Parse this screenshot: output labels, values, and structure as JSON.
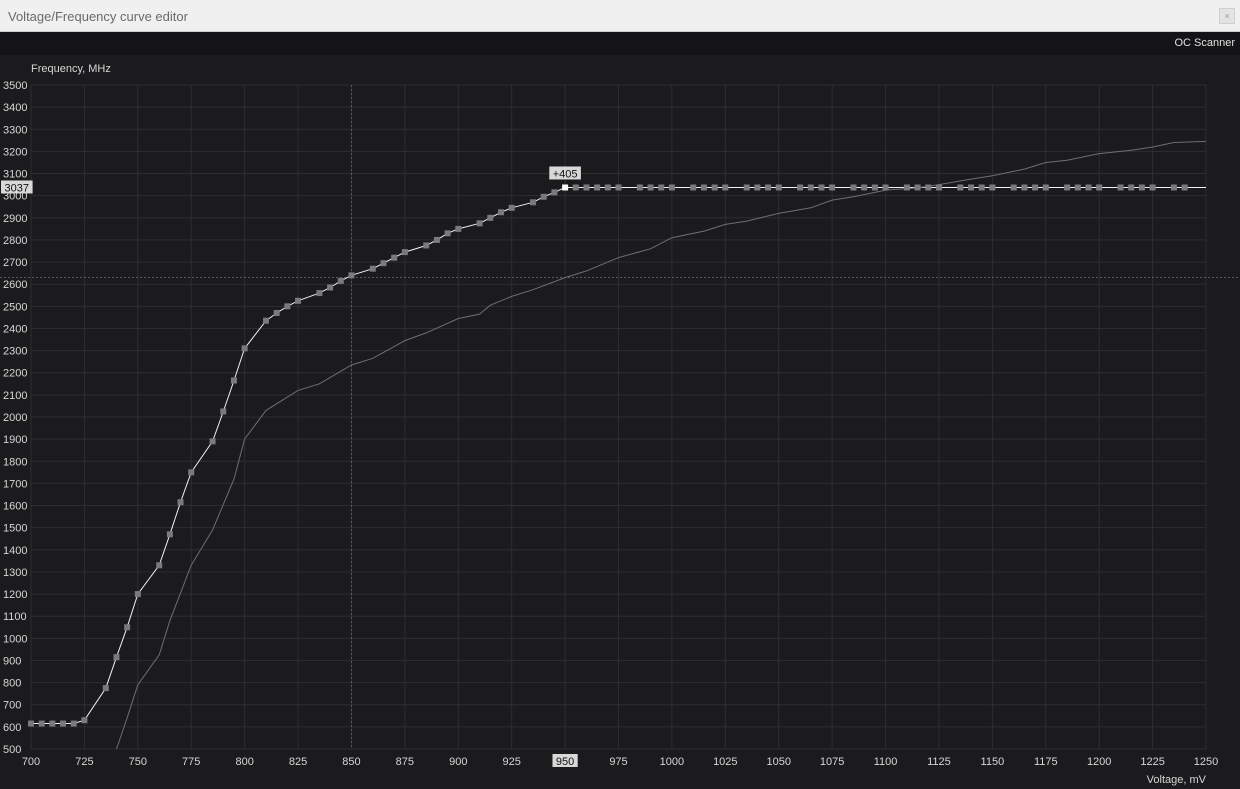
{
  "window": {
    "title": "Voltage/Frequency curve editor",
    "close_label": "×"
  },
  "toolbar": {
    "oc_scanner_label": "OC Scanner"
  },
  "colors": {
    "background": "#1b1b1d",
    "grid": "#2e2e31",
    "curve_active": "#f2f2f2",
    "curve_default": "#6f6f72",
    "point": "#7a7a7d",
    "point_selected": "#ffffff",
    "label_bg": "#d8d8d8",
    "label_text": "#111111"
  },
  "chart_data": {
    "type": "line",
    "xlabel": "Voltage, mV",
    "ylabel": "Frequency, MHz",
    "xlim": [
      700,
      1250
    ],
    "ylim": [
      500,
      3500
    ],
    "xticks": [
      700,
      725,
      750,
      775,
      800,
      825,
      850,
      875,
      900,
      925,
      950,
      975,
      1000,
      1025,
      1050,
      1075,
      1100,
      1125,
      1150,
      1175,
      1200,
      1225,
      1250
    ],
    "yticks": [
      500,
      600,
      700,
      800,
      900,
      1000,
      1100,
      1200,
      1300,
      1400,
      1500,
      1600,
      1700,
      1800,
      1900,
      2000,
      2100,
      2200,
      2300,
      2400,
      2500,
      2600,
      2700,
      2800,
      2900,
      3000,
      3100,
      3200,
      3300,
      3400,
      3500
    ],
    "grid": true,
    "selected": {
      "voltage": 950,
      "frequency": 3037,
      "offset_label": "+405",
      "voltage_label": "950",
      "frequency_label": "3037"
    },
    "cursor": {
      "voltage": 850,
      "frequency": 2630
    },
    "series": [
      {
        "role": "edited-curve",
        "points": [
          [
            700,
            615
          ],
          [
            705,
            615
          ],
          [
            710,
            615
          ],
          [
            715,
            615
          ],
          [
            720,
            615
          ],
          [
            725,
            630
          ],
          [
            735,
            775
          ],
          [
            740,
            915
          ],
          [
            745,
            1050
          ],
          [
            750,
            1200
          ],
          [
            760,
            1330
          ],
          [
            765,
            1470
          ],
          [
            770,
            1615
          ],
          [
            775,
            1750
          ],
          [
            785,
            1890
          ],
          [
            790,
            2025
          ],
          [
            795,
            2165
          ],
          [
            800,
            2310
          ],
          [
            810,
            2435
          ],
          [
            815,
            2470
          ],
          [
            820,
            2500
          ],
          [
            825,
            2525
          ],
          [
            835,
            2560
          ],
          [
            840,
            2585
          ],
          [
            845,
            2615
          ],
          [
            850,
            2640
          ],
          [
            860,
            2670
          ],
          [
            865,
            2695
          ],
          [
            870,
            2720
          ],
          [
            875,
            2745
          ],
          [
            885,
            2775
          ],
          [
            890,
            2800
          ],
          [
            895,
            2830
          ],
          [
            900,
            2850
          ],
          [
            910,
            2875
          ],
          [
            915,
            2900
          ],
          [
            920,
            2925
          ],
          [
            925,
            2945
          ],
          [
            935,
            2970
          ],
          [
            940,
            2995
          ],
          [
            945,
            3015
          ],
          [
            950,
            3037
          ],
          [
            955,
            3037
          ],
          [
            960,
            3037
          ],
          [
            965,
            3037
          ],
          [
            970,
            3037
          ],
          [
            975,
            3037
          ],
          [
            985,
            3037
          ],
          [
            990,
            3037
          ],
          [
            995,
            3037
          ],
          [
            1000,
            3037
          ],
          [
            1010,
            3037
          ],
          [
            1015,
            3037
          ],
          [
            1020,
            3037
          ],
          [
            1025,
            3037
          ],
          [
            1035,
            3037
          ],
          [
            1040,
            3037
          ],
          [
            1045,
            3037
          ],
          [
            1050,
            3037
          ],
          [
            1060,
            3037
          ],
          [
            1065,
            3037
          ],
          [
            1070,
            3037
          ],
          [
            1075,
            3037
          ],
          [
            1085,
            3037
          ],
          [
            1090,
            3037
          ],
          [
            1095,
            3037
          ],
          [
            1100,
            3037
          ],
          [
            1110,
            3037
          ],
          [
            1115,
            3037
          ],
          [
            1120,
            3037
          ],
          [
            1125,
            3037
          ],
          [
            1135,
            3037
          ],
          [
            1140,
            3037
          ],
          [
            1145,
            3037
          ],
          [
            1150,
            3037
          ],
          [
            1160,
            3037
          ],
          [
            1165,
            3037
          ],
          [
            1170,
            3037
          ],
          [
            1175,
            3037
          ],
          [
            1185,
            3037
          ],
          [
            1190,
            3037
          ],
          [
            1195,
            3037
          ],
          [
            1200,
            3037
          ],
          [
            1210,
            3037
          ],
          [
            1215,
            3037
          ],
          [
            1220,
            3037
          ],
          [
            1225,
            3037
          ],
          [
            1235,
            3037
          ],
          [
            1240,
            3037
          ],
          [
            1250,
            3037
          ]
        ]
      },
      {
        "role": "default-curve",
        "points": [
          [
            740,
            500
          ],
          [
            745,
            640
          ],
          [
            750,
            790
          ],
          [
            760,
            925
          ],
          [
            765,
            1080
          ],
          [
            775,
            1330
          ],
          [
            785,
            1490
          ],
          [
            795,
            1720
          ],
          [
            800,
            1900
          ],
          [
            810,
            2030
          ],
          [
            825,
            2120
          ],
          [
            835,
            2150
          ],
          [
            850,
            2235
          ],
          [
            860,
            2265
          ],
          [
            875,
            2345
          ],
          [
            885,
            2380
          ],
          [
            900,
            2445
          ],
          [
            910,
            2465
          ],
          [
            915,
            2505
          ],
          [
            925,
            2545
          ],
          [
            935,
            2575
          ],
          [
            950,
            2630
          ],
          [
            960,
            2660
          ],
          [
            975,
            2720
          ],
          [
            990,
            2760
          ],
          [
            1000,
            2810
          ],
          [
            1015,
            2840
          ],
          [
            1025,
            2870
          ],
          [
            1035,
            2885
          ],
          [
            1050,
            2920
          ],
          [
            1065,
            2945
          ],
          [
            1075,
            2980
          ],
          [
            1085,
            2995
          ],
          [
            1100,
            3025
          ],
          [
            1115,
            3035
          ],
          [
            1125,
            3050
          ],
          [
            1140,
            3075
          ],
          [
            1150,
            3090
          ],
          [
            1165,
            3120
          ],
          [
            1175,
            3150
          ],
          [
            1185,
            3160
          ],
          [
            1200,
            3190
          ],
          [
            1215,
            3205
          ],
          [
            1225,
            3220
          ],
          [
            1235,
            3240
          ],
          [
            1250,
            3245
          ]
        ]
      }
    ]
  }
}
